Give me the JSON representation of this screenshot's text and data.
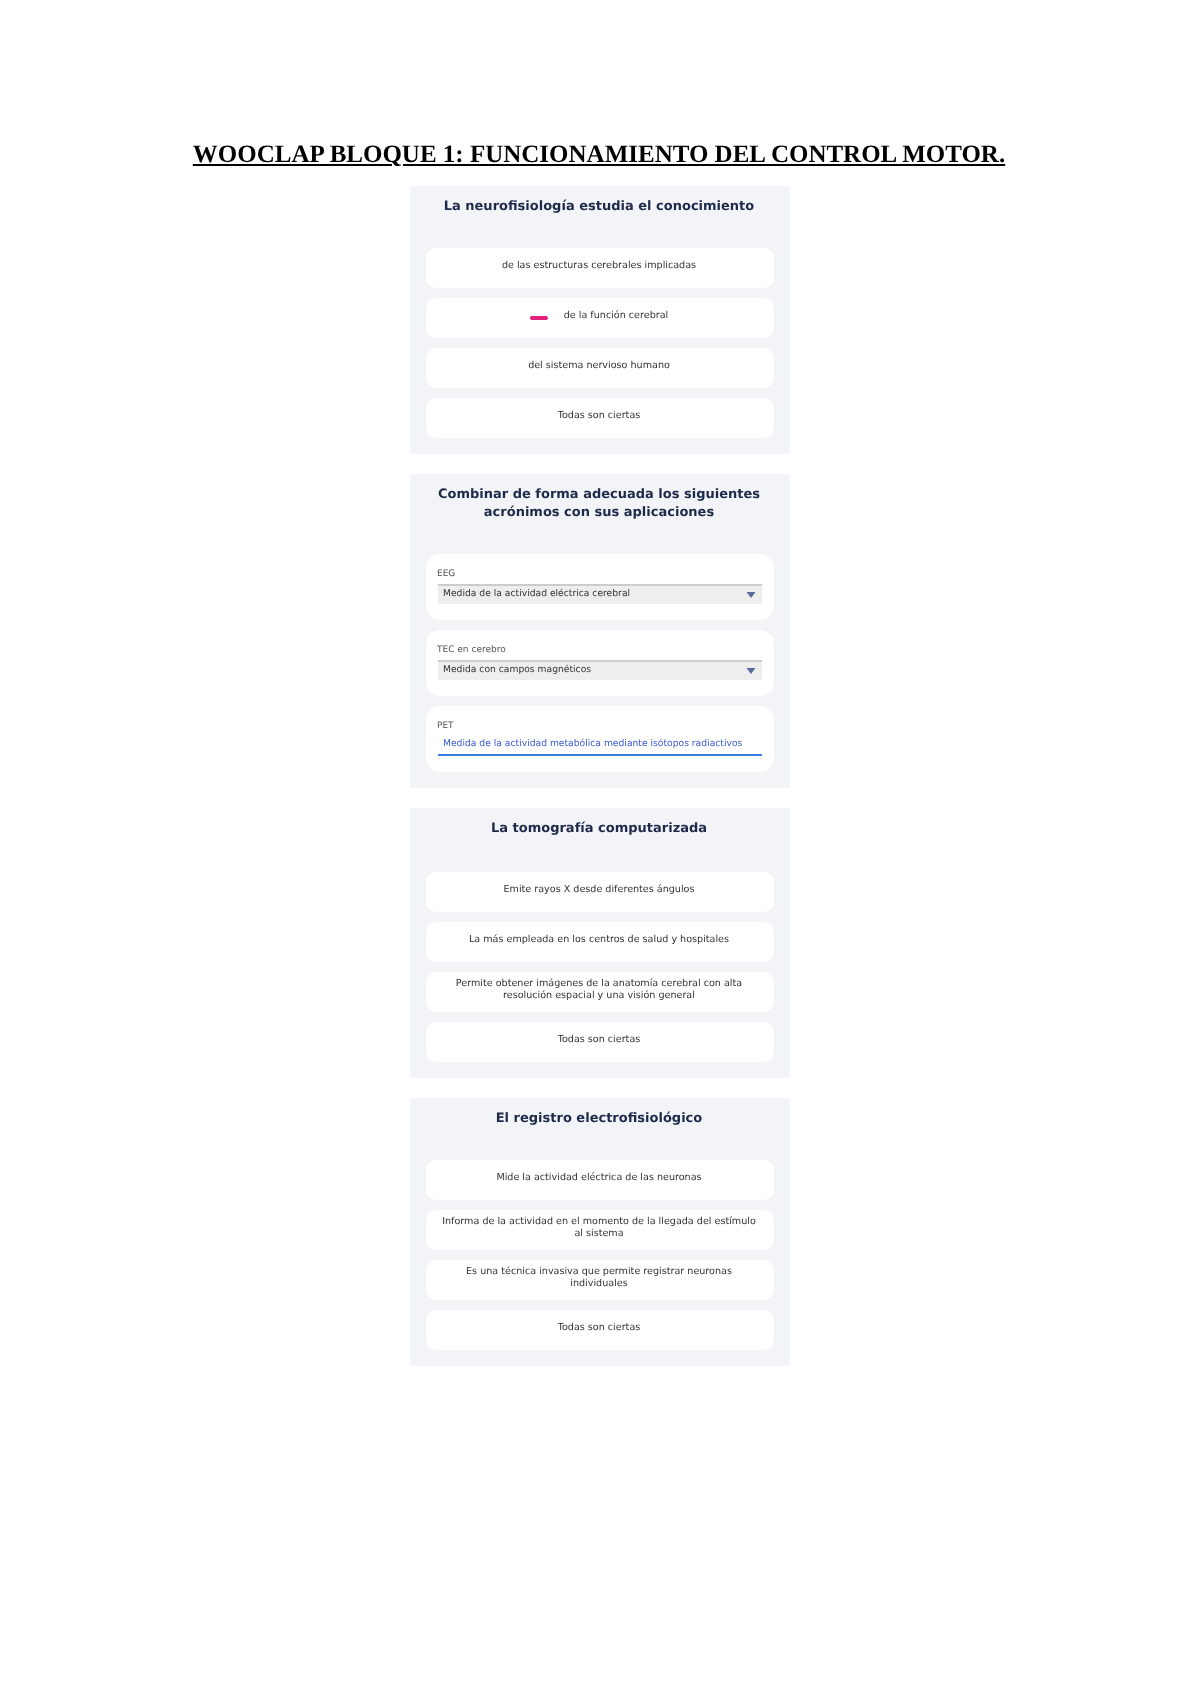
{
  "heading": "WOOCLAP BLOQUE 1: FUNCIONAMIENTO DEL CONTROL MOTOR.",
  "panels": [
    {
      "kind": "choices",
      "question": "La neurofisiología estudia el conocimiento",
      "options": [
        {
          "text": "de las estructuras cerebrales implicadas",
          "marked": false
        },
        {
          "text": "de la función cerebral",
          "marked": true
        },
        {
          "text": "del sistema nervioso humano",
          "marked": false
        },
        {
          "text": "Todas son ciertas",
          "marked": false
        }
      ]
    },
    {
      "kind": "matching",
      "question": "Combinar de forma adecuada los siguientes acrónimos con sus aplicaciones",
      "pairs": [
        {
          "label": "EEG",
          "value": "Medida de la actividad eléctrica cerebral",
          "focused": false
        },
        {
          "label": "TEC en cerebro",
          "value": "Medida con campos magnéticos",
          "focused": false
        },
        {
          "label": "PET",
          "value": "Medida de la actividad metabólica mediante isótopos radiactivos",
          "focused": true
        }
      ]
    },
    {
      "kind": "choices",
      "question": "La tomografía computarizada",
      "options": [
        {
          "text": "Emite rayos X desde diferentes ángulos",
          "marked": false
        },
        {
          "text": "La más empleada en los centros de salud y hospitales",
          "marked": false
        },
        {
          "text": "Permite obtener imágenes de la anatomía cerebral con alta resolución espacial y una visión general",
          "marked": false
        },
        {
          "text": "Todas son ciertas",
          "marked": false
        }
      ]
    },
    {
      "kind": "choices",
      "question": "El registro electrofisiológico",
      "options": [
        {
          "text": "Mide la actividad eléctrica de las neuronas",
          "marked": false
        },
        {
          "text": "Informa de la actividad en el momento de la llegada del estímulo al sistema",
          "marked": false
        },
        {
          "text": "Es una técnica invasiva que permite registrar neuronas individuales",
          "marked": false
        },
        {
          "text": "Todas son ciertas",
          "marked": false
        }
      ]
    }
  ]
}
